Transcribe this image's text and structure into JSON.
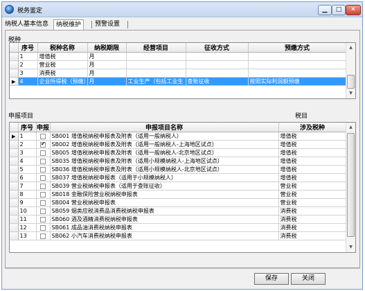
{
  "window": {
    "title": "税务鉴定"
  },
  "tabs": [
    {
      "label": "纳税人基本信息"
    },
    {
      "label": "纳税维护"
    },
    {
      "label": "预警设置"
    }
  ],
  "tax_section": {
    "label": "税种",
    "columns": [
      "序号",
      "税种名称",
      "纳税期限",
      "经营项目",
      "征收方式",
      "预缴方式"
    ],
    "rows": [
      {
        "no": "1",
        "name": "增值税",
        "period": "月",
        "business": "",
        "method": "",
        "prepay": ""
      },
      {
        "no": "2",
        "name": "营业税",
        "period": "月",
        "business": "",
        "method": "",
        "prepay": ""
      },
      {
        "no": "3",
        "name": "消费税",
        "period": "月",
        "business": "",
        "method": "",
        "prepay": ""
      },
      {
        "no": "4",
        "name": "企业所得税（预缴）",
        "period": "月",
        "business": "工业生产（包括工业生",
        "method": "查账征收",
        "prepay": "按照实际利润额预缴"
      }
    ],
    "selected_row": 3
  },
  "declare_section": {
    "label": "申报项目",
    "right_label": "税目",
    "columns": [
      "序号",
      "申报",
      "申报项目名称",
      "涉及税种"
    ],
    "rows": [
      {
        "no": "1",
        "checked": false,
        "code": "SB001",
        "name": "增值税纳税申报表及附表（适用一般纳税人）",
        "tax": "增值税"
      },
      {
        "no": "2",
        "checked": true,
        "code": "SB002",
        "name": "增值税纳税申报表及附表（适用一般纳税人-上海地区试点）",
        "tax": "增值税"
      },
      {
        "no": "3",
        "checked": false,
        "code": "SB005",
        "name": "增值税纳税申报表及附表（适用一般纳税人-北京地区试点）",
        "tax": "增值税"
      },
      {
        "no": "4",
        "checked": false,
        "code": "SB035",
        "name": "增值税纳税申报表及附表（适用小规模纳税人-上海地区试点）",
        "tax": "增值税"
      },
      {
        "no": "5",
        "checked": false,
        "code": "SB036",
        "name": "增值税纳税申报表及附表（适用小规模纳税人-北京地区试点）",
        "tax": "增值税"
      },
      {
        "no": "6",
        "checked": false,
        "code": "SB037",
        "name": "增值税纳税申报表（适用于小规模纳税人）",
        "tax": "增值税"
      },
      {
        "no": "7",
        "checked": false,
        "code": "SB039",
        "name": "营业税纳税申报表（适用于查账征收）",
        "tax": "营业税"
      },
      {
        "no": "8",
        "checked": false,
        "code": "SB018",
        "name": "金融保险营业税纳税申报表",
        "tax": "营业税"
      },
      {
        "no": "9",
        "checked": false,
        "code": "SB004",
        "name": "营业税纳税申报表",
        "tax": "营业税"
      },
      {
        "no": "10",
        "checked": false,
        "code": "SB059",
        "name": "烟类应税消费品消费税纳税申报表",
        "tax": "消费税"
      },
      {
        "no": "11",
        "checked": false,
        "code": "SB060",
        "name": "酒及酒精消费税纳税申报表",
        "tax": "消费税"
      },
      {
        "no": "12",
        "checked": false,
        "code": "SB061",
        "name": "成品油消费税纳税申报表",
        "tax": "消费税"
      },
      {
        "no": "13",
        "checked": false,
        "code": "SB062",
        "name": "小汽车消费税纳税申报表",
        "tax": "消费税"
      }
    ],
    "current_row": 0
  },
  "buttons": {
    "save": "保存",
    "close": "关闭"
  },
  "icons": {
    "window": "app-icon",
    "minimize": "minimize-icon",
    "maximize": "maximize-icon",
    "close": "close-icon",
    "row_indicator": "row-pointer-icon",
    "scroll_up": "scroll-up-arrow-icon",
    "scroll_down": "scroll-down-arrow-icon"
  },
  "colors": {
    "selection": "#3399ff",
    "title_bar": "#c5d7ef",
    "close_button": "#c94531"
  }
}
